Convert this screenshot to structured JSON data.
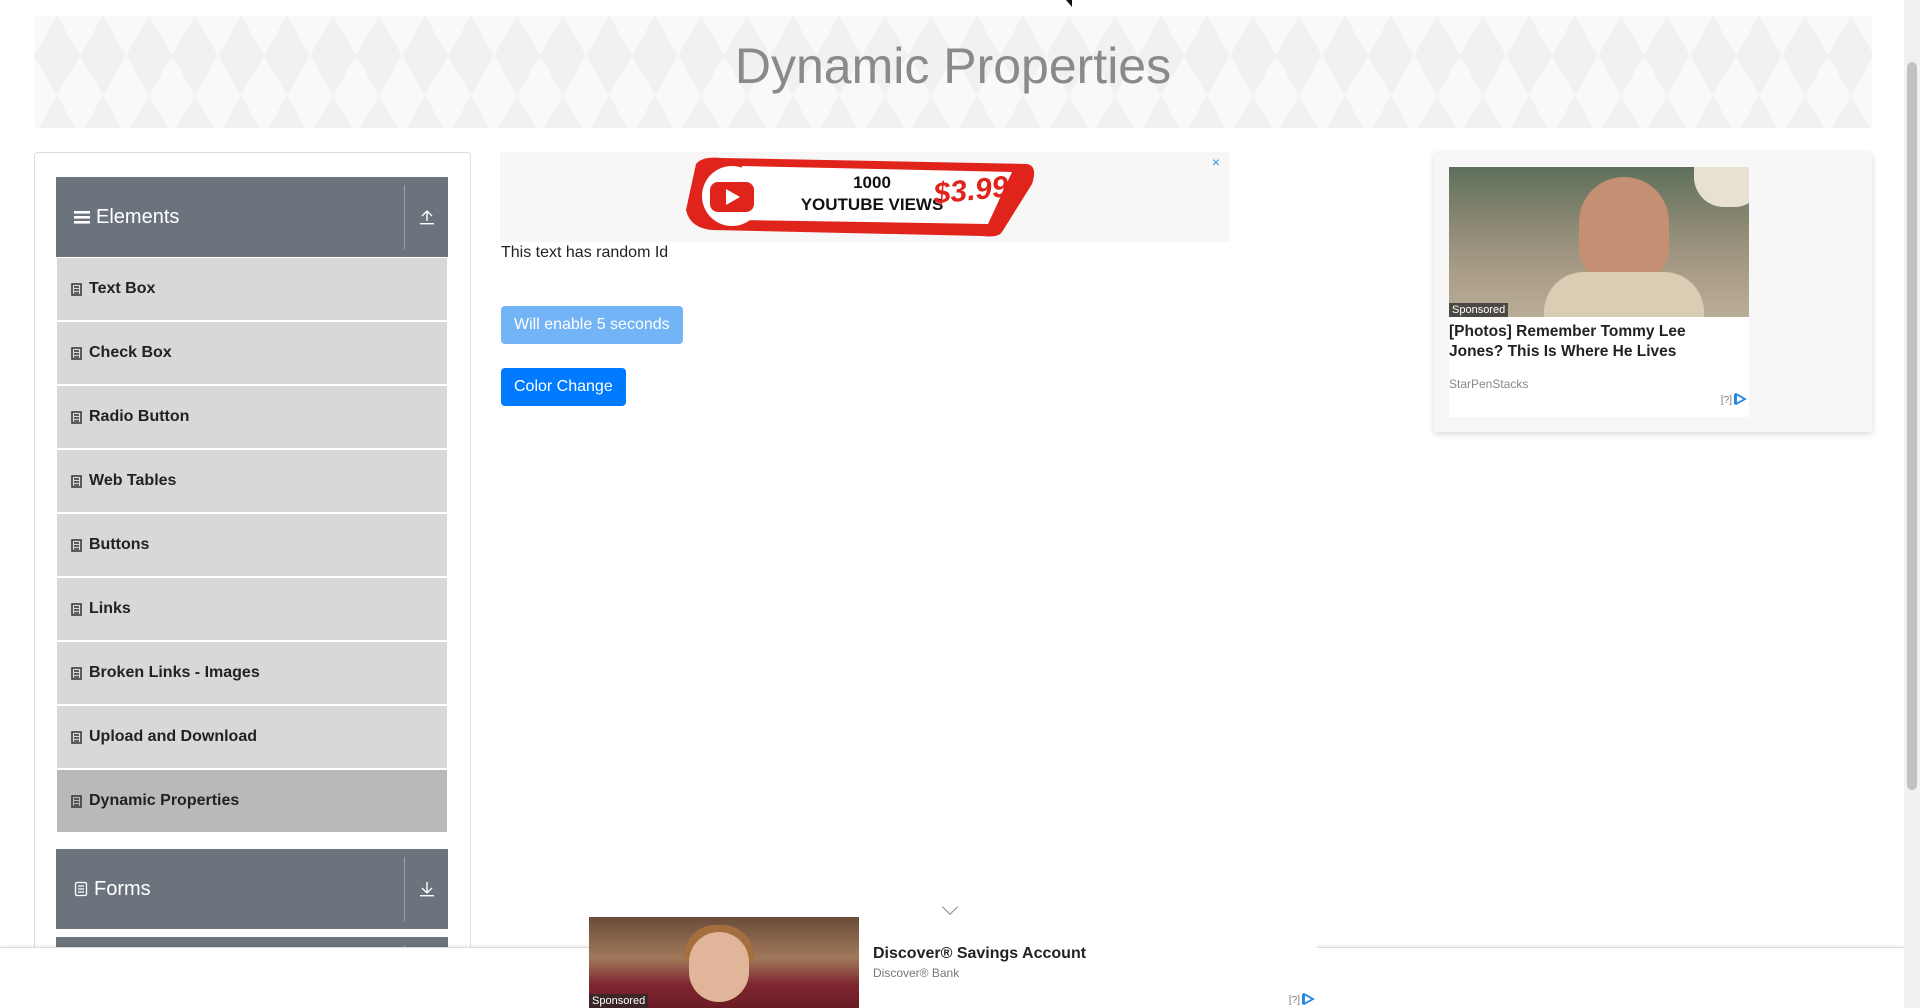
{
  "header": {
    "title": "Dynamic Properties"
  },
  "sidebar": {
    "groups": [
      {
        "label": "Elements",
        "icon": "bars-icon",
        "toggle_icon": "upload-arrow-icon"
      },
      {
        "label": "Forms",
        "icon": "document-icon",
        "toggle_icon": "download-arrow-icon"
      }
    ],
    "items": [
      {
        "label": "Text Box"
      },
      {
        "label": "Check Box"
      },
      {
        "label": "Radio Button"
      },
      {
        "label": "Web Tables"
      },
      {
        "label": "Buttons"
      },
      {
        "label": "Links"
      },
      {
        "label": "Broken Links - Images"
      },
      {
        "label": "Upload and Download"
      },
      {
        "label": "Dynamic Properties",
        "active": true
      }
    ]
  },
  "main": {
    "random_text": "This text has random Id",
    "enable_button": "Will enable 5 seconds",
    "color_button": "Color Change"
  },
  "ad_top": {
    "line1": "1000",
    "line2": "YOUTUBE VIEWS",
    "price": "$3.99",
    "close": "×"
  },
  "ad_right": {
    "sponsored": "Sponsored",
    "headline": "[Photos] Remember Tommy Lee Jones? This Is Where He Lives",
    "source": "StarPenStacks",
    "adchoice": "[?]"
  },
  "ad_bottom": {
    "sponsored": "Sponsored",
    "title": "Discover® Savings Account",
    "source": "Discover® Bank",
    "adchoice": "[?]"
  },
  "colors": {
    "header_bg": "#6b747c",
    "item_bg": "#d8d8d8",
    "active_bg": "#b9b9b9",
    "primary": "#007bff",
    "disabled": "#72b4f5"
  }
}
